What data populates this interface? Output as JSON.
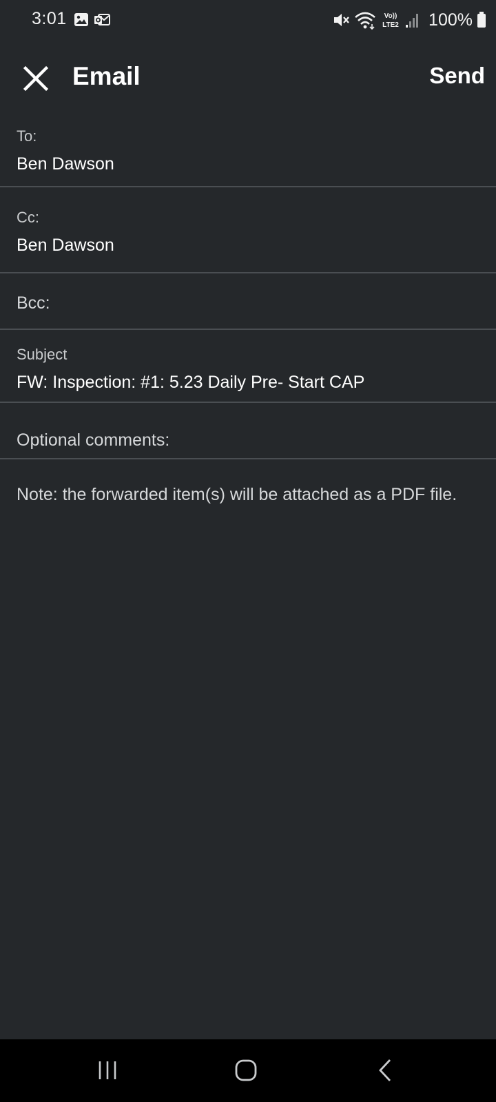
{
  "status_bar": {
    "time": "3:01",
    "battery": "100%",
    "network_label": "Vo)) LTE2",
    "icons": [
      "image-icon",
      "outlook-icon",
      "mute-icon",
      "wifi-icon",
      "volte-icon",
      "signal-icon",
      "battery-icon"
    ]
  },
  "app_bar": {
    "title": "Email",
    "send_label": "Send"
  },
  "form": {
    "to_label": "To:",
    "to_value": "Ben Dawson",
    "cc_label": "Cc:",
    "cc_value": "Ben Dawson",
    "bcc_label": "Bcc:",
    "subject_label": "Subject",
    "subject_value": "FW: Inspection: #1: 5.23 Daily Pre- Start CAP",
    "comments_placeholder": "Optional comments:"
  },
  "note": "Note: the forwarded item(s) will be attached as a PDF file.",
  "nav_bar": {
    "buttons": [
      "recents-icon",
      "home-icon",
      "back-icon"
    ]
  },
  "colors": {
    "background": "#25282b",
    "divider": "#4a4e52",
    "nav_background": "#000000"
  }
}
